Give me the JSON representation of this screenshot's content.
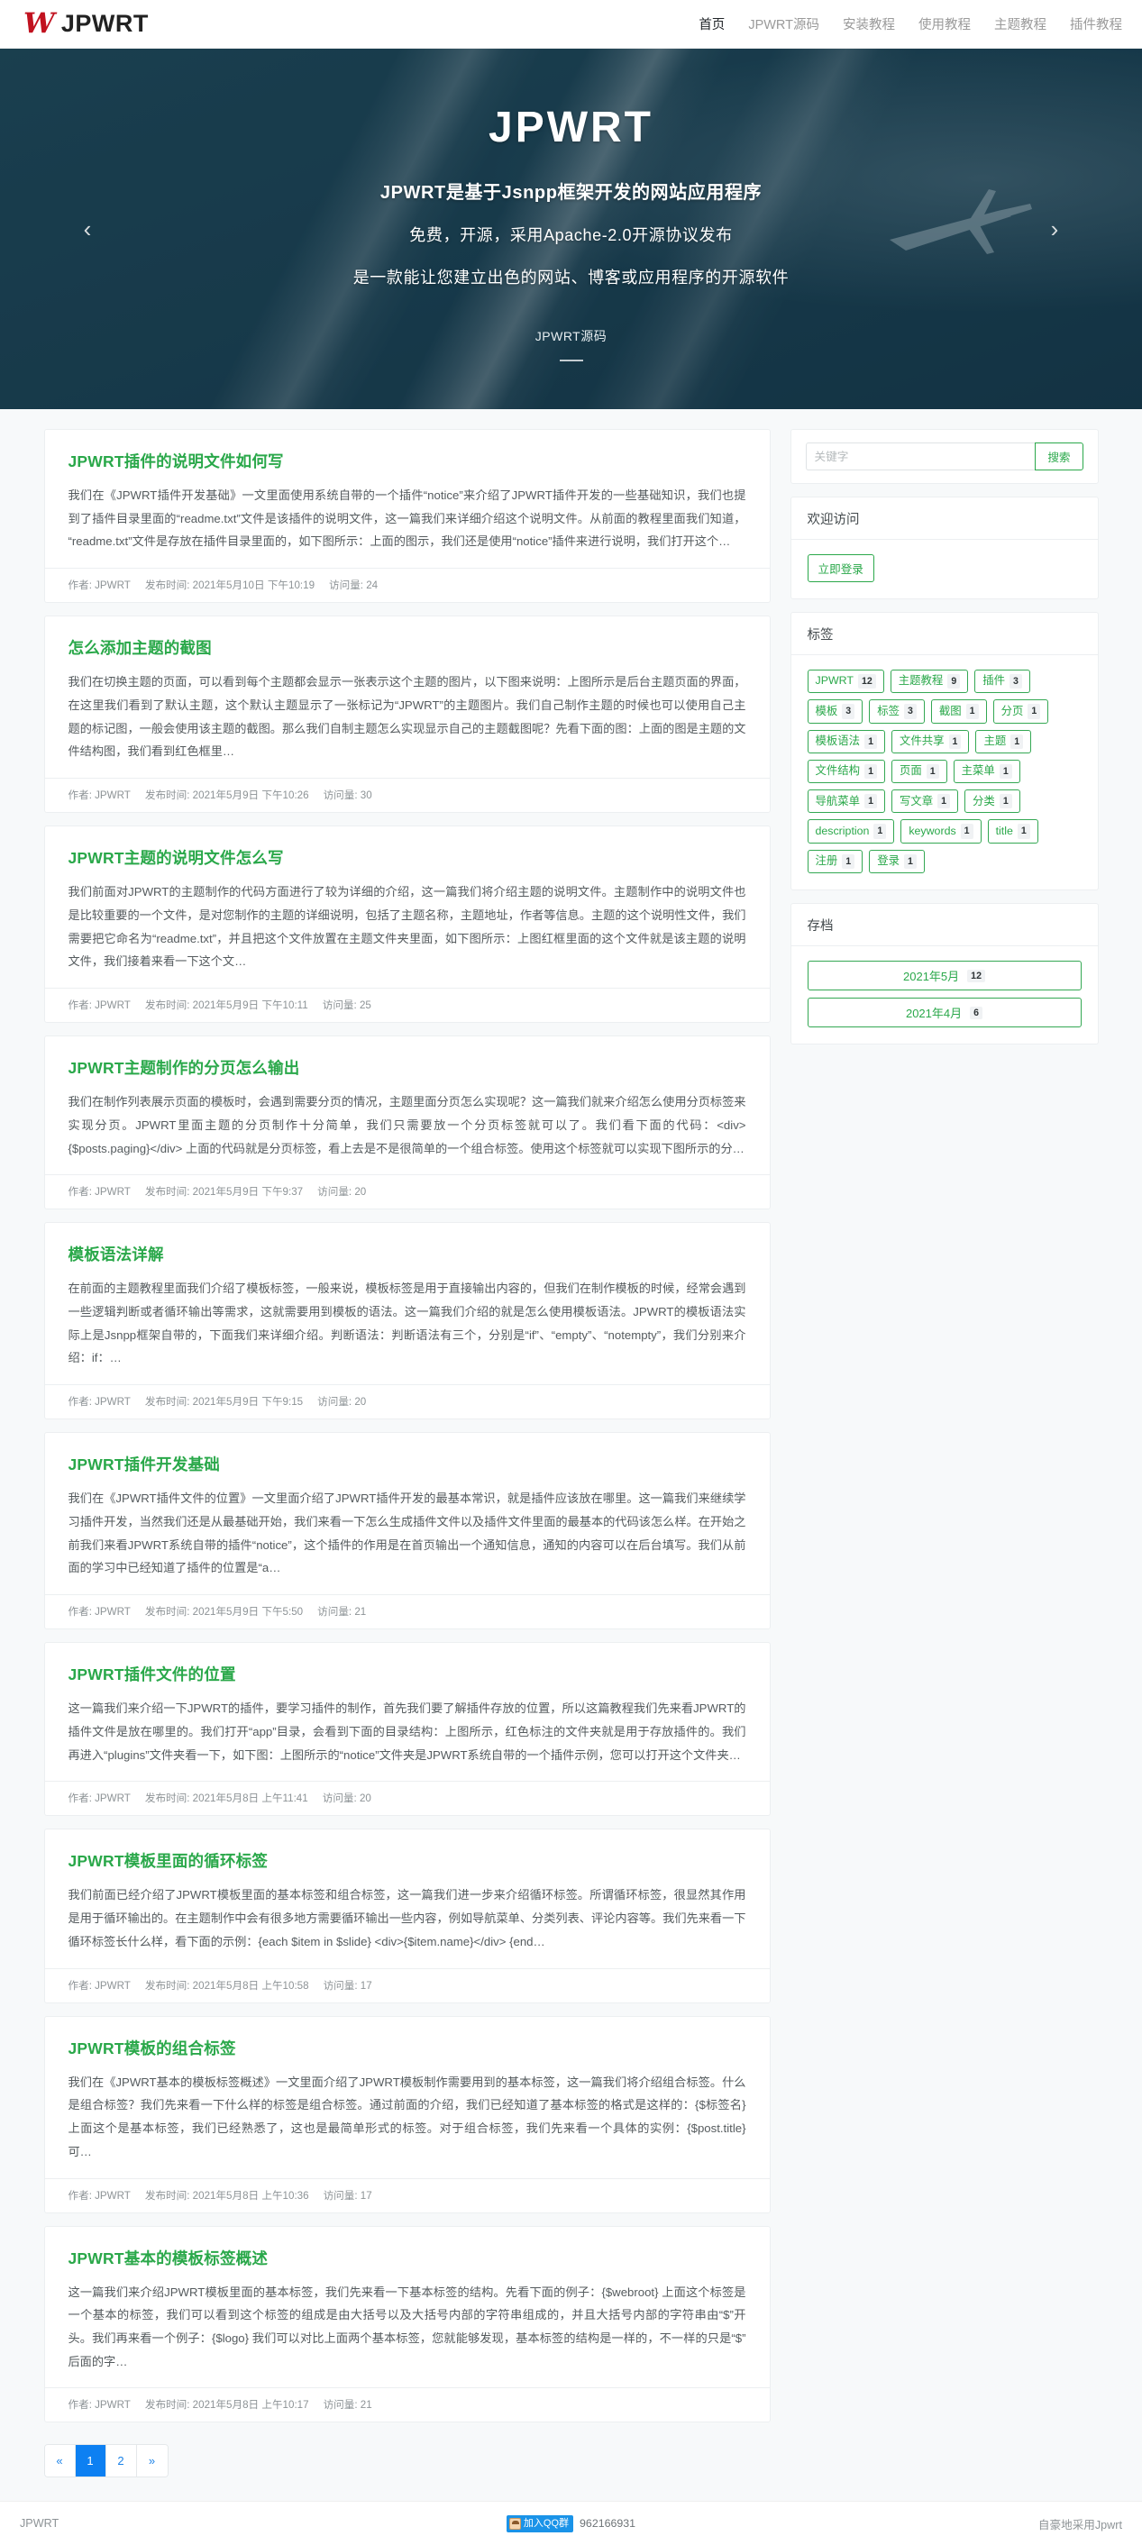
{
  "header": {
    "brand_mark": "W",
    "brand_text": "JPWRT",
    "nav": [
      {
        "label": "首页",
        "active": true
      },
      {
        "label": "JPWRT源码",
        "active": false
      },
      {
        "label": "安装教程",
        "active": false
      },
      {
        "label": "使用教程",
        "active": false
      },
      {
        "label": "主题教程",
        "active": false
      },
      {
        "label": "插件教程",
        "active": false
      }
    ]
  },
  "hero": {
    "title": "JPWRT",
    "subtitle": "JPWRT是基于Jsnpp框架开发的网站应用程序",
    "line2": "免费，开源，采用Apache-2.0开源协议发布",
    "line3": "是一款能让您建立出色的网站、博客或应用程序的开源软件",
    "caption": "JPWRT源码",
    "prev_icon": "‹",
    "next_icon": "›"
  },
  "posts": [
    {
      "title": "JPWRT插件的说明文件如何写",
      "excerpt": "我们在《JPWRT插件开发基础》一文里面使用系统自带的一个插件“notice”来介绍了JPWRT插件开发的一些基础知识，我们也提到了插件目录里面的“readme.txt”文件是该插件的说明文件，这一篇我们来详细介绍这个说明文件。从前面的教程里面我们知道，“readme.txt”文件是存放在插件目录里面的，如下图所示：上面的图示，我们还是使用“notice”插件来进行说明，我们打开这个…",
      "author": "作者: JPWRT",
      "date": "发布时间: 2021年5月10日 下午10:19",
      "views": "访问量: 24"
    },
    {
      "title": "怎么添加主题的截图",
      "excerpt": "我们在切换主题的页面，可以看到每个主题都会显示一张表示这个主题的图片，以下图来说明：上图所示是后台主题页面的界面，在这里我们看到了默认主题，这个默认主题显示了一张标记为“JPWRT”的主题图片。我们自己制作主题的时候也可以使用自己主题的标记图，一般会使用该主题的截图。那么我们自制主题怎么实现显示自己的主题截图呢？先看下面的图：上面的图是主题的文件结构图，我们看到红色框里…",
      "author": "作者: JPWRT",
      "date": "发布时间: 2021年5月9日 下午10:26",
      "views": "访问量: 30"
    },
    {
      "title": "JPWRT主题的说明文件怎么写",
      "excerpt": "我们前面对JPWRT的主题制作的代码方面进行了较为详细的介绍，这一篇我们将介绍主题的说明文件。主题制作中的说明文件也是比较重要的一个文件，是对您制作的主题的详细说明，包括了主题名称，主题地址，作者等信息。主题的这个说明性文件，我们需要把它命名为“readme.txt”，并且把这个文件放置在主题文件夹里面，如下图所示：上图红框里面的这个文件就是该主题的说明文件，我们接着来看一下这个文…",
      "author": "作者: JPWRT",
      "date": "发布时间: 2021年5月9日 下午10:11",
      "views": "访问量: 25"
    },
    {
      "title": "JPWRT主题制作的分页怎么输出",
      "excerpt": "我们在制作列表展示页面的模板时，会遇到需要分页的情况，主题里面分页怎么实现呢？这一篇我们就来介绍怎么使用分页标签来实现分页。JPWRT里面主题的分页制作十分简单，我们只需要放一个分页标签就可以了。我们看下面的代码：<div>{$posts.paging}</div> 上面的代码就是分页标签，看上去是不是很简单的一个组合标签。使用这个标签就可以实现下图所示的分…",
      "author": "作者: JPWRT",
      "date": "发布时间: 2021年5月9日 下午9:37",
      "views": "访问量: 20"
    },
    {
      "title": "模板语法详解",
      "excerpt": "在前面的主题教程里面我们介绍了模板标签，一般来说，模板标签是用于直接输出内容的，但我们在制作模板的时候，经常会遇到一些逻辑判断或者循环输出等需求，这就需要用到模板的语法。这一篇我们介绍的就是怎么使用模板语法。JPWRT的模板语法实际上是Jsnpp框架自带的，下面我们来详细介绍。判断语法：判断语法有三个，分别是“if”、“empty”、“notempty”，我们分别来介绍：if：…",
      "author": "作者: JPWRT",
      "date": "发布时间: 2021年5月9日 下午9:15",
      "views": "访问量: 20"
    },
    {
      "title": "JPWRT插件开发基础",
      "excerpt": "我们在《JPWRT插件文件的位置》一文里面介绍了JPWRT插件开发的最基本常识，就是插件应该放在哪里。这一篇我们来继续学习插件开发，当然我们还是从最基础开始，我们来看一下怎么生成插件文件以及插件文件里面的最基本的代码该怎么样。在开始之前我们来看JPWRT系统自带的插件“notice”，这个插件的作用是在首页输出一个通知信息，通知的内容可以在后台填写。我们从前面的学习中已经知道了插件的位置是“a…",
      "author": "作者: JPWRT",
      "date": "发布时间: 2021年5月9日 下午5:50",
      "views": "访问量: 21"
    },
    {
      "title": "JPWRT插件文件的位置",
      "excerpt": "这一篇我们来介绍一下JPWRT的插件，要学习插件的制作，首先我们要了解插件存放的位置，所以这篇教程我们先来看JPWRT的插件文件是放在哪里的。我们打开“app”目录，会看到下面的目录结构：上图所示，红色标注的文件夹就是用于存放插件的。我们再进入“plugins”文件夹看一下，如下图：上图所示的“notice”文件夹是JPWRT系统自带的一个插件示例，您可以打开这个文件夹…",
      "author": "作者: JPWRT",
      "date": "发布时间: 2021年5月8日 上午11:41",
      "views": "访问量: 20"
    },
    {
      "title": "JPWRT模板里面的循环标签",
      "excerpt": "我们前面已经介绍了JPWRT模板里面的基本标签和组合标签，这一篇我们进一步来介绍循环标签。所谓循环标签，很显然其作用是用于循环输出的。在主题制作中会有很多地方需要循环输出一些内容，例如导航菜单、分类列表、评论内容等。我们先来看一下循环标签长什么样，看下面的示例：{each $item in $slide} <div>{$item.name}</div> {end…",
      "author": "作者: JPWRT",
      "date": "发布时间: 2021年5月8日 上午10:58",
      "views": "访问量: 17"
    },
    {
      "title": "JPWRT模板的组合标签",
      "excerpt": "我们在《JPWRT基本的模板标签概述》一文里面介绍了JPWRT模板制作需要用到的基本标签，这一篇我们将介绍组合标签。什么是组合标签？我们先来看一下什么样的标签是组合标签。通过前面的介绍，我们已经知道了基本标签的格式是这样的：{$标签名} 上面这个是基本标签，我们已经熟悉了，这也是最简单形式的标签。对于组合标签，我们先来看一个具体的实例：{$post.title} 可…",
      "author": "作者: JPWRT",
      "date": "发布时间: 2021年5月8日 上午10:36",
      "views": "访问量: 17"
    },
    {
      "title": "JPWRT基本的模板标签概述",
      "excerpt": "这一篇我们来介绍JPWRT模板里面的基本标签，我们先来看一下基本标签的结构。先看下面的例子：{$webroot} 上面这个标签是一个基本的标签，我们可以看到这个标签的组成是由大括号以及大括号内部的字符串组成的，并且大括号内部的字符串由“$”开头。我们再来看一个例子：{$logo} 我们可以对比上面两个基本标签，您就能够发现，基本标签的结构是一样的，不一样的只是“$”后面的字…",
      "author": "作者: JPWRT",
      "date": "发布时间: 2021年5月8日 上午10:17",
      "views": "访问量: 21"
    }
  ],
  "sidebar": {
    "search": {
      "placeholder": "关键字",
      "value": "",
      "button_label": "搜索"
    },
    "welcome": {
      "title": "欢迎访问",
      "login_label": "立即登录"
    },
    "tags": {
      "title": "标签",
      "items": [
        {
          "label": "JPWRT",
          "count": "12"
        },
        {
          "label": "主题教程",
          "count": "9"
        },
        {
          "label": "插件",
          "count": "3"
        },
        {
          "label": "模板",
          "count": "3"
        },
        {
          "label": "标签",
          "count": "3"
        },
        {
          "label": "截图",
          "count": "1"
        },
        {
          "label": "分页",
          "count": "1"
        },
        {
          "label": "模板语法",
          "count": "1"
        },
        {
          "label": "文件共享",
          "count": "1"
        },
        {
          "label": "主题",
          "count": "1"
        },
        {
          "label": "文件结构",
          "count": "1"
        },
        {
          "label": "页面",
          "count": "1"
        },
        {
          "label": "主菜单",
          "count": "1"
        },
        {
          "label": "导航菜单",
          "count": "1"
        },
        {
          "label": "写文章",
          "count": "1"
        },
        {
          "label": "分类",
          "count": "1"
        },
        {
          "label": "description",
          "count": "1"
        },
        {
          "label": "keywords",
          "count": "1"
        },
        {
          "label": "title",
          "count": "1"
        },
        {
          "label": "注册",
          "count": "1"
        },
        {
          "label": "登录",
          "count": "1"
        }
      ]
    },
    "archive": {
      "title": "存档",
      "items": [
        {
          "label": "2021年5月",
          "count": "12"
        },
        {
          "label": "2021年4月",
          "count": "6"
        }
      ]
    }
  },
  "pagination": {
    "first_label": "«",
    "last_label": "»",
    "pages": [
      {
        "label": "1",
        "current": true
      },
      {
        "label": "2",
        "current": false
      }
    ]
  },
  "footer": {
    "left": "JPWRT",
    "qq_label": "加入QQ群",
    "qq_number": "962166931",
    "right": "自豪地采用Jpwrt"
  },
  "colors": {
    "brand_green": "#2aa84a",
    "logo_red": "#c1121f",
    "page_active": "#0d80f2",
    "hero_bg": "#1d4455"
  }
}
